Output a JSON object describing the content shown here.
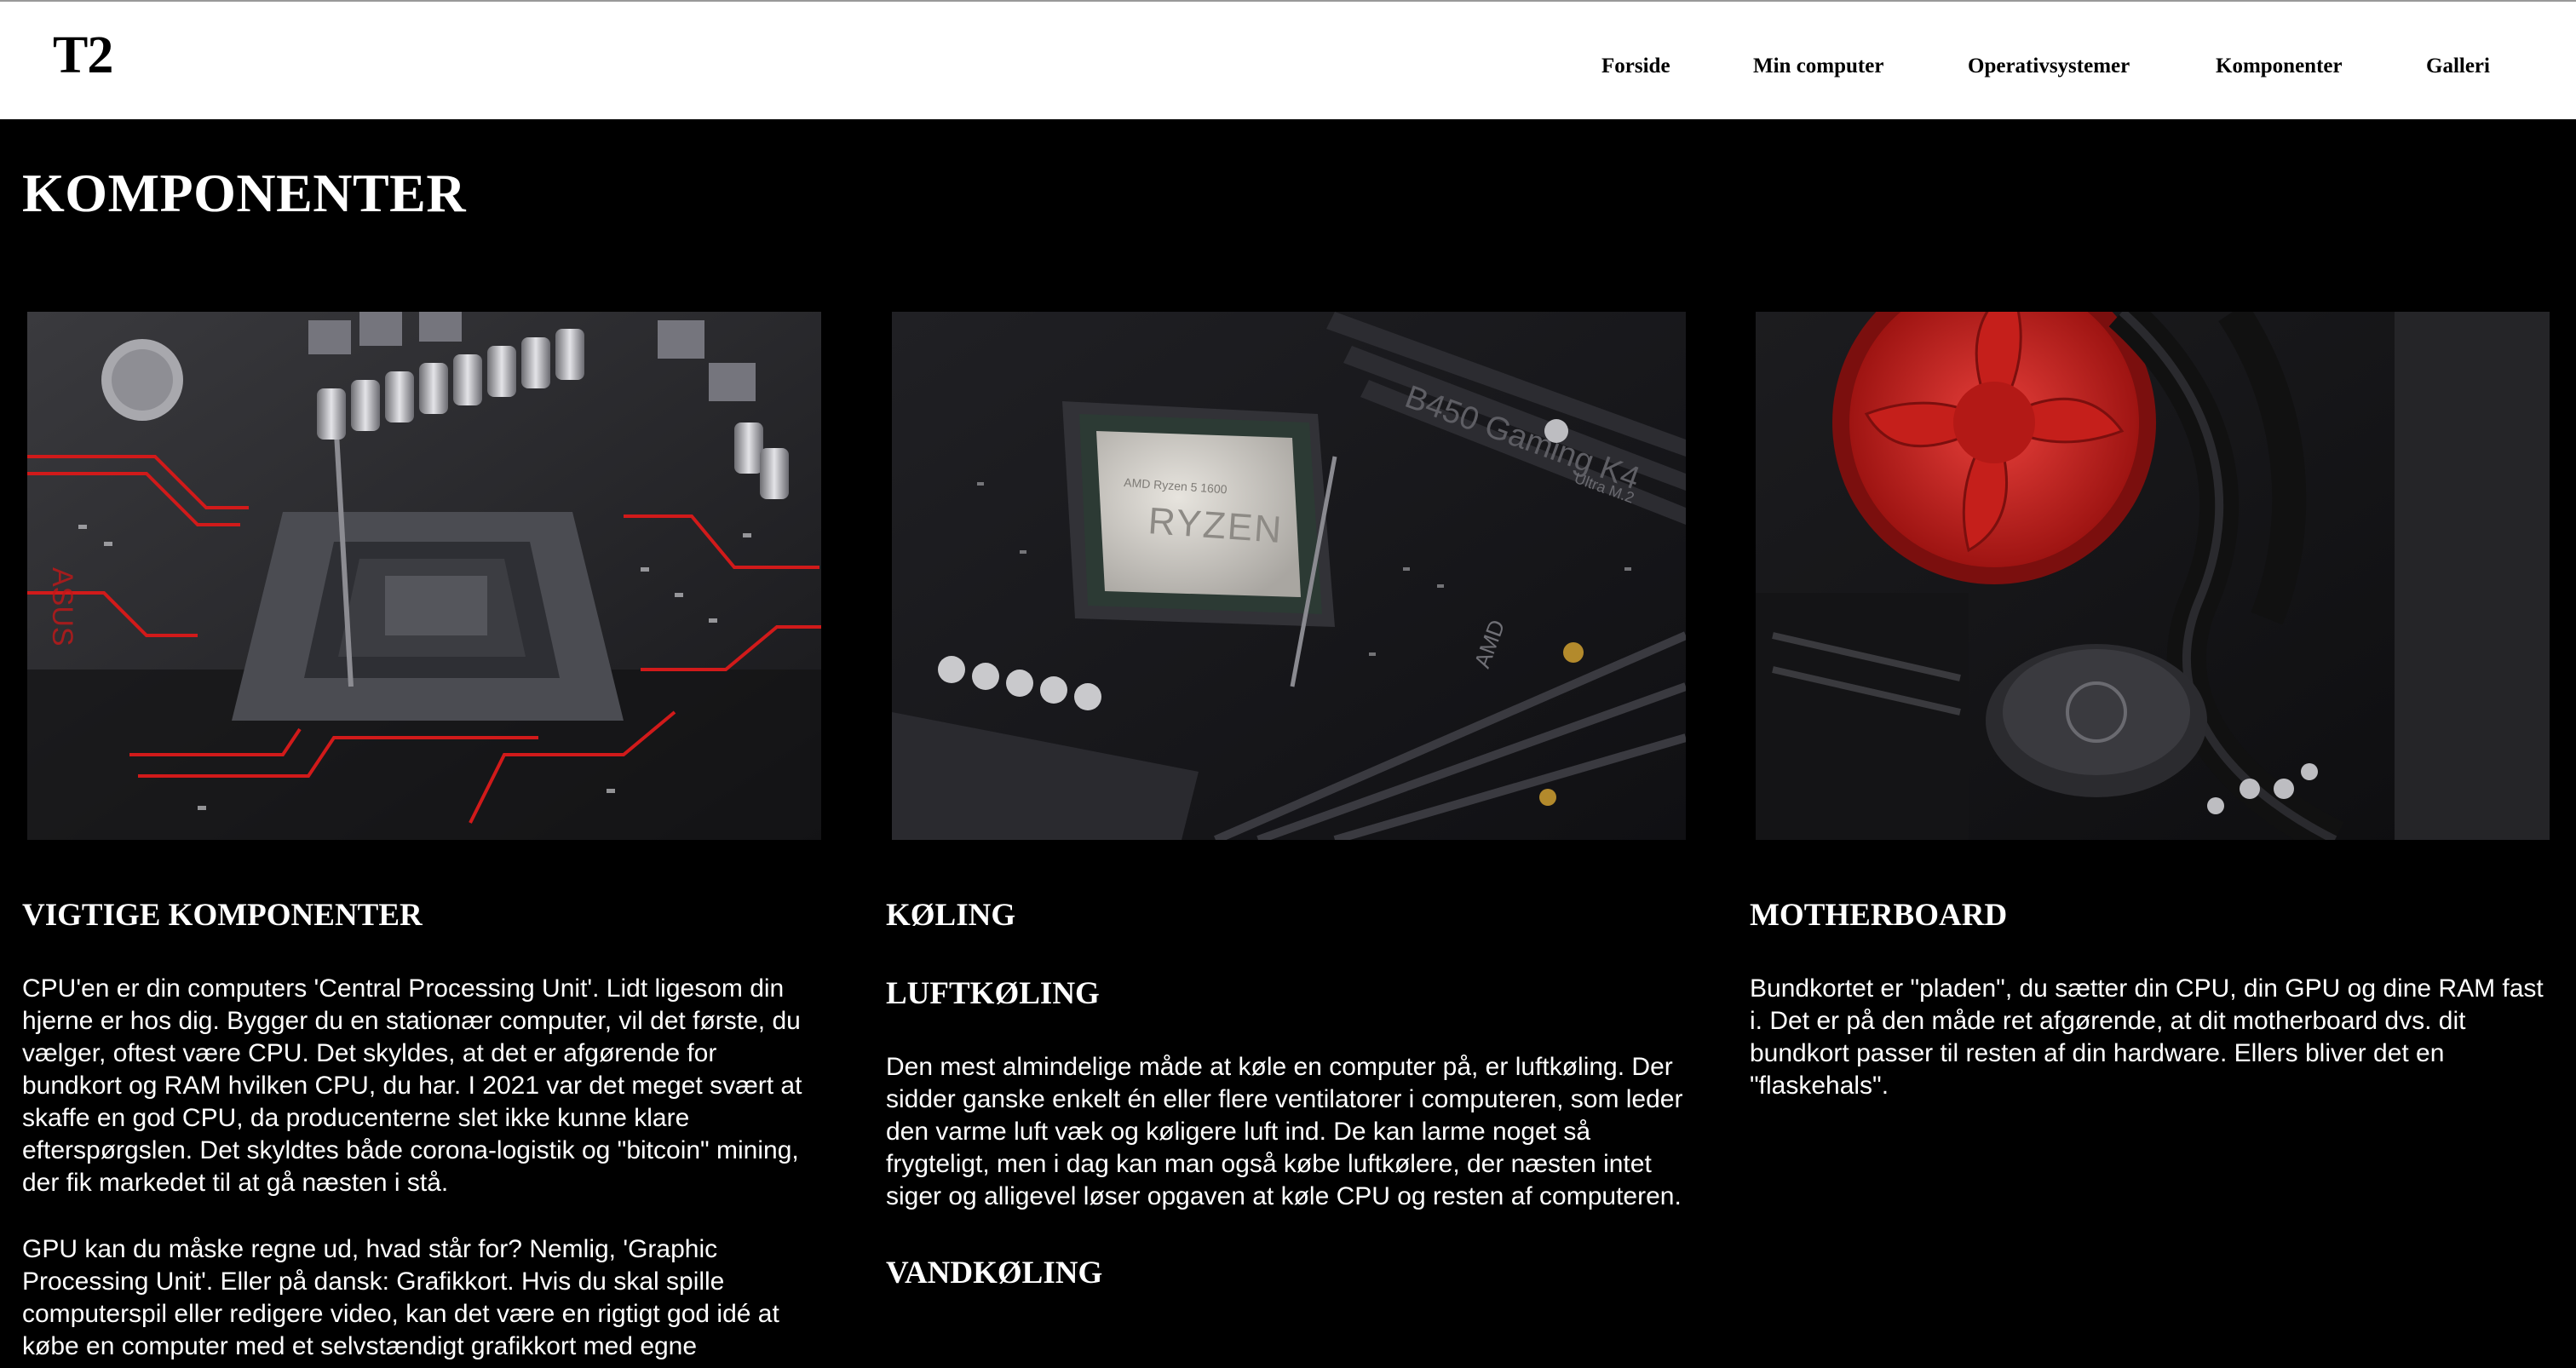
{
  "header": {
    "logo": "T2",
    "nav": [
      "Forside",
      "Min computer",
      "Operativsystemer",
      "Komponenter",
      "Galleri"
    ]
  },
  "page": {
    "title": "KOMPONENTER"
  },
  "columns": [
    {
      "heading": "VIGTIGE KOMPONENTER",
      "paragraphs": [
        "CPU'en er din computers 'Central Processing Unit'. Lidt ligesom din hjerne er hos dig. Bygger du en stationær computer, vil det første, du vælger, oftest være CPU. Det skyldes, at det er afgørende for bundkort og RAM hvilken CPU, du har. I 2021 var det meget svært at skaffe en god CPU, da producenterne slet ikke kunne klare efterspørgslen. Det skyldtes både corona-logistik og \"bitcoin\" mining, der fik markedet til at gå næsten i stå.",
        "GPU kan du måske regne ud, hvad står for? Nemlig, 'Graphic Processing Unit'. Eller på dansk: Grafikkort. Hvis du skal spille computerspil eller redigere video, kan det være en rigtigt god idé at købe en computer med et selvstændigt grafikkort med egne"
      ]
    },
    {
      "heading": "KØLING",
      "sub1": "LUFTKØLING",
      "text1": "Den mest almindelige måde at køle en computer på, er luftkøling. Der sidder ganske enkelt én eller flere ventilatorer i computeren, som leder den varme luft væk og køligere luft ind. De kan larme noget så frygteligt, men i dag kan man også købe luftkølere, der næsten intet siger og alligevel løser opgaven at køle CPU og resten af computeren.",
      "sub2": "VANDKØLING"
    },
    {
      "heading": "MOTHERBOARD",
      "text1": "Bundkortet er \"pladen\", du sætter din CPU, din GPU og dine RAM fast i. Det er på den måde ret afgørende, at dit motherboard dvs. dit bundkort passer til resten af din hardware. Ellers bliver det en \"flaskehals\"."
    }
  ],
  "images": {
    "cpu_label_top": "AMD Ryzen 5 1600",
    "cpu_label": "RYZEN",
    "board_text": "B450 Gaming K4",
    "board_text2": "Ultra M.2",
    "board_text3": "AMD",
    "board_text4": "ASUS"
  }
}
